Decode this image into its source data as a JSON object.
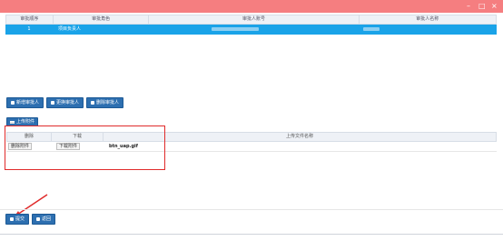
{
  "window": {
    "title": "",
    "controls": {
      "minimize": "–",
      "maximize": "□",
      "close": "×"
    }
  },
  "approver_grid": {
    "columns": [
      "审批顺序",
      "审批角色",
      "审批人账号",
      "审批人名称"
    ],
    "rows": [
      {
        "order": "1",
        "role": "项目负责人",
        "account": "",
        "name": ""
      }
    ]
  },
  "approver_toolbar": {
    "add_label": "新增审批人",
    "edit_label": "更换审批人",
    "delete_label": "删除审批人"
  },
  "attachment": {
    "upload_label": "上传附件",
    "columns": {
      "delete": "删除",
      "download": "下载",
      "filename": "上传文件名称"
    },
    "rows": [
      {
        "delete_label": "删除附件",
        "download_label": "下载附件",
        "filename": "btn_uap.gif"
      }
    ]
  },
  "footer": {
    "submit_label": "提交",
    "back_label": "返回"
  },
  "colors": {
    "titlebar": "#f57e80",
    "selected_row": "#1aa3e8",
    "button": "#2d6fb0",
    "highlight_box": "#e02b2b"
  }
}
